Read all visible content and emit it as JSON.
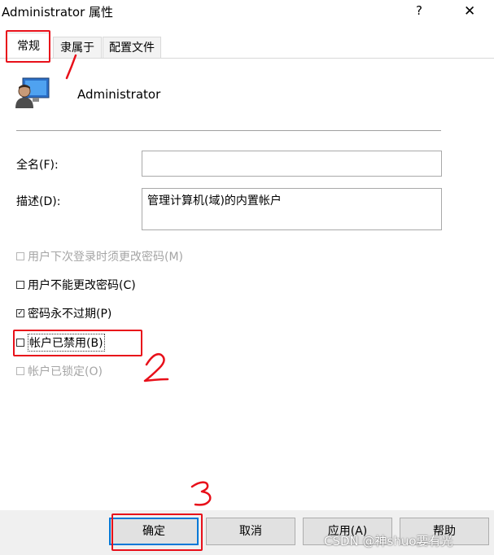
{
  "window": {
    "title": "Administrator 属性",
    "help_label": "?",
    "close_label": "✕"
  },
  "tabs": [
    {
      "label": "常规"
    },
    {
      "label": "隶属于"
    },
    {
      "label": "配置文件"
    }
  ],
  "user": {
    "name": "Administrator",
    "icon": "user-computer-icon"
  },
  "fields": {
    "fullname_label": "全名(F):",
    "fullname_value": "",
    "description_label": "描述(D):",
    "description_value": "管理计算机(域)的内置帐户"
  },
  "checkboxes": [
    {
      "label": "用户下次登录时须更改密码(M)",
      "checked": false,
      "disabled": true
    },
    {
      "label": "用户不能更改密码(C)",
      "checked": false,
      "disabled": false
    },
    {
      "label": "密码永不过期(P)",
      "checked": true,
      "disabled": false
    },
    {
      "label": "帐户已禁用(B)",
      "checked": false,
      "disabled": false
    },
    {
      "label": "帐户已锁定(O)",
      "checked": false,
      "disabled": true
    }
  ],
  "buttons": {
    "ok": "确定",
    "cancel": "取消",
    "apply": "应用(A)",
    "help": "帮助"
  },
  "annotations": {
    "mark_1": "1",
    "mark_2": "2",
    "mark_3": "3",
    "color": "#e8101a"
  },
  "watermark": "CSDN @神shuo要有光"
}
